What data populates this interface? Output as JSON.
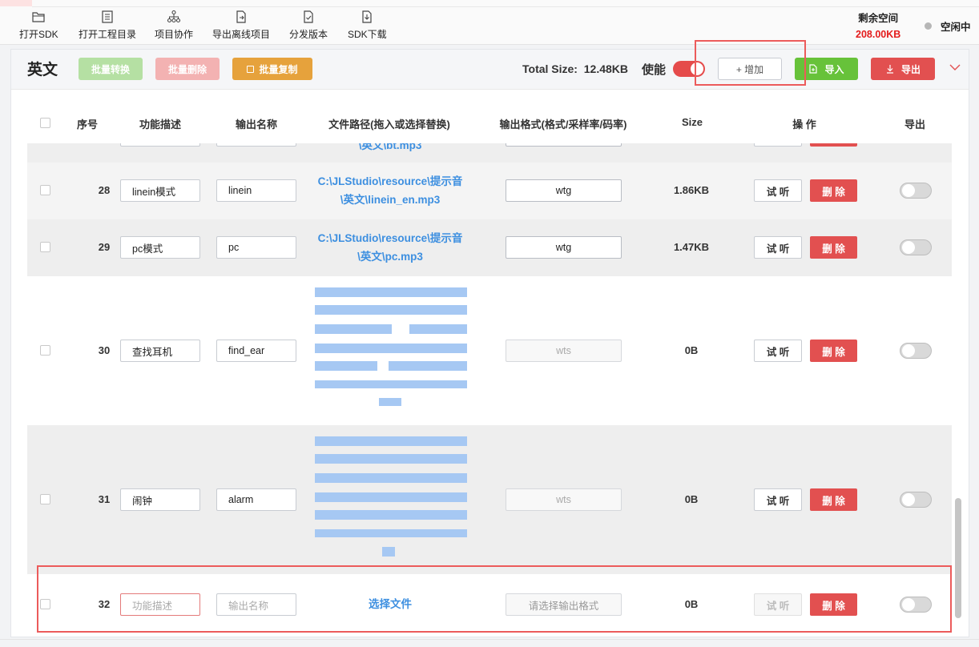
{
  "toolbar": {
    "items": [
      {
        "label": "打开SDK",
        "icon": "folder-open-icon"
      },
      {
        "label": "打开工程目录",
        "icon": "list-doc-icon"
      },
      {
        "label": "项目协作",
        "icon": "hierarchy-icon"
      },
      {
        "label": "导出离线项目",
        "icon": "file-export-icon"
      },
      {
        "label": "分发版本",
        "icon": "file-check-icon"
      },
      {
        "label": "SDK下载",
        "icon": "file-download-icon"
      }
    ],
    "space_label": "剩余空间",
    "space_value": "208.00KB",
    "status": "空闲中"
  },
  "panel": {
    "language": "英文",
    "batch_convert": "批量转换",
    "batch_delete": "批量删除",
    "batch_copy": "批量复制",
    "total_size_label": "Total Size:",
    "total_size_value": "12.48KB",
    "enable_label": "使能",
    "add_label": "+ 增加",
    "import_label": "导入",
    "export_label": "导出"
  },
  "columns": [
    "序号",
    "功能描述",
    "输出名称",
    "文件路径(拖入或选择替换)",
    "输出格式(格式/采样率/码率)",
    "Size",
    "操 作",
    "导出"
  ],
  "rows": [
    {
      "index": "28",
      "desc": "linein模式",
      "name": "linein",
      "path_line1": "C:\\JLStudio\\resource\\提示音",
      "path_line2": "\\英文\\linein_en.mp3",
      "format": "wtg",
      "size": "1.86KB"
    },
    {
      "index": "29",
      "desc": "pc模式",
      "name": "pc",
      "path_line1": "C:\\JLStudio\\resource\\提示音",
      "path_line2": "\\英文\\pc.mp3",
      "format": "wtg",
      "size": "1.47KB"
    },
    {
      "index": "30",
      "desc": "查找耳机",
      "name": "find_ear",
      "format": "wts",
      "size": "0B"
    },
    {
      "index": "31",
      "desc": "闹钟",
      "name": "alarm",
      "format": "wts",
      "size": "0B"
    },
    {
      "index": "32",
      "desc_placeholder": "功能描述",
      "name_placeholder": "输出名称",
      "path_action": "选择文件",
      "format_placeholder": "请选择输出格式",
      "size": "0B"
    }
  ],
  "partial_row_text": "\\英文\\bt.mp3",
  "actions": {
    "listen": "试 听",
    "delete": "删 除"
  },
  "colors": {
    "red": "#e25050",
    "green": "#67c23a",
    "orange": "#e6a23c",
    "link": "#3d8fe0"
  }
}
